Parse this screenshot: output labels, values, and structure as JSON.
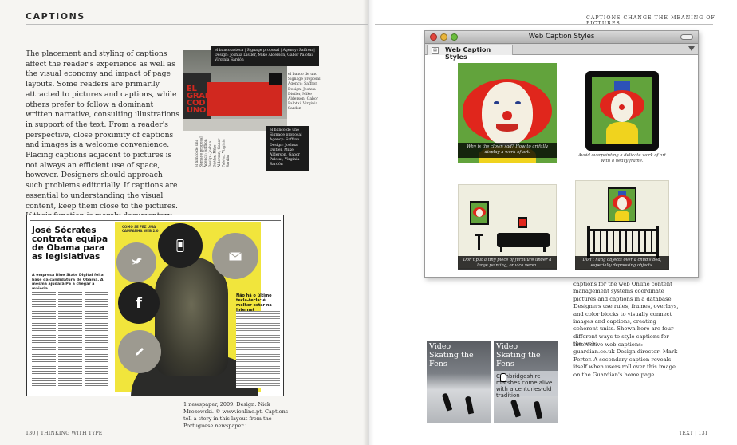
{
  "left_page": {
    "section_title": "CAPTIONS",
    "body_text": "The placement and styling of captions affect the reader's experience as well as the visual economy and impact of page layouts. Some readers are primarily attracted to pictures and captions, while others prefer to follow a dominant written narrative, consulting illustrations in support of the text. From a reader's perspective, close proximity of captions and images is a welcome convenience. Placing captions adjacent to pictures is not always an efficient use of space, however. Designers should approach such problems editorially. If captions are essential to understanding the visual content, keep them close to the pictures. If their function is merely documentary, adjacency is more easily sacrificed.",
    "folio": "130 | THINKING WITH TYPE",
    "poster": {
      "title_lines": [
        "EL",
        "GRAN",
        "COD",
        "UNO"
      ],
      "caption_top": "el banco azteca | Signage proposal | Agency: Saffron | Design: Joshua Distler, Mike Alderson, Gabor Palotai, Virginia Sardón",
      "caption_mid": "el banco de uno Signage proposal Agency: Saffron Design: Joshua Distler, Mike Alderson, Gabor Palotai, Virginia Sardón",
      "caption_bottom": "el banco de uno Signage proposal Agency: Saffron Design: Joshua Distler, Mike Alderson, Gabor Palotai, Virginia Sardón",
      "caption_vertical": "el banco de uno Signage proposal Agency: Saffron Design: Joshua Distler, Mike Alderson, Gabor Palotai, Virginia Sardón"
    },
    "newspaper": {
      "headline": "José Sócrates contrata equipa de Obama para as legislativas",
      "subhead": "A empresa Blue State Digital foi a base da candidatura de Obama. A mesma ajudará PS a chegar à maioria",
      "kicker": "COMO SE FEZ UMA CAMPANHA WEB 2.0",
      "sidebar_head": "Não há o último tecla-tecla: é melhor estar na Internet",
      "icon_labels": [
        "bird-icon",
        "phone-icon",
        "mail-icon",
        "facebook-icon",
        "pen-icon"
      ],
      "caption": "1 newspaper, 2009. Design: Nick Mrozowski. © www.ionline.pt. Captions tell a story in this layout from the Portuguese newspaper i."
    }
  },
  "right_page": {
    "running_head": "captions change the meaning of pictures",
    "folio": "TEXT | 131",
    "browser": {
      "window_title": "Web Caption Styles",
      "tab_label": "Web Caption Styles",
      "captions": [
        "Why is the clown sad? How to artfully display a work of art.",
        "Avoid overpainting a delicate work of art with a heavy frame.",
        "Don't put a tiny piece of furniture under a large painting, or vice versa.",
        "Don't hang objects over a child's bed, especially depressing objects."
      ]
    },
    "caption_web": "captions for the web Online content management systems coordinate pictures and captions in a database. Designers use rules, frames, overlays, and color blocks to visually connect images and captions, creating coherent units. Shown here are four different ways to style captions for the web.",
    "caption_guardian": "interactive web captions: guardian.co.uk Design director: Mark Porter. A secondary caption reveals itself when users roll over this image on the Guardian's home page.",
    "videos": [
      {
        "label": "Video",
        "title": "Skating the Fens"
      },
      {
        "label": "Video",
        "title": "Skating the Fens",
        "overlay": "Cambridgeshire marshes come alive with a centuries-old tradition"
      }
    ]
  },
  "colors": {
    "newspaper_yellow": "#f1e53c",
    "poster_red": "#d1281f",
    "clown_bg": "#62a33c"
  }
}
